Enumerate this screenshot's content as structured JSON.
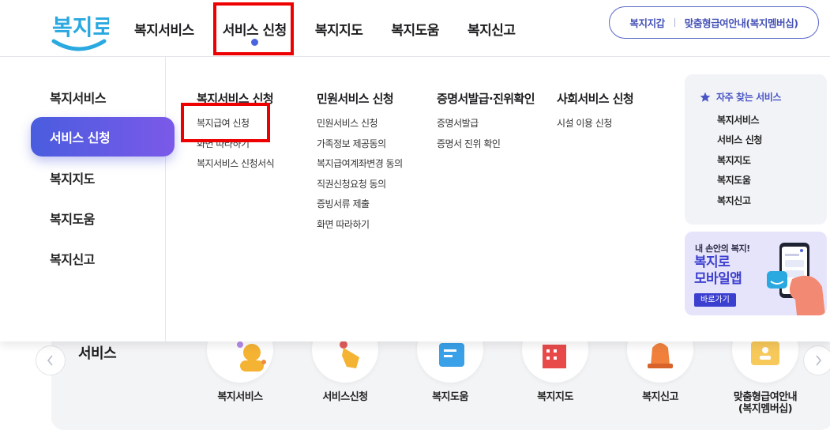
{
  "header": {
    "logo_text": "복지로",
    "nav": [
      "복지서비스",
      "서비스 신청",
      "복지지도",
      "복지도움",
      "복지신고"
    ],
    "util_links": [
      "복지지갑",
      "맞춤형급여안내(복지멤버십)"
    ]
  },
  "mega_menu": {
    "side_nav": [
      "복지서비스",
      "서비스 신청",
      "복지지도",
      "복지도움",
      "복지신고"
    ],
    "columns": [
      {
        "title": "복지서비스 신청",
        "items": [
          "복지급여 신청",
          "화면 따라하기",
          "복지서비스 신청서식"
        ]
      },
      {
        "title": "민원서비스 신청",
        "items": [
          "민원서비스 신청",
          "가족정보 제공동의",
          "복지급여계좌변경 동의",
          "직권신청요청 동의",
          "증빙서류 제출",
          "화면 따라하기"
        ]
      },
      {
        "title": "증명서발급·진위확인",
        "items": [
          "증명서발급",
          "증명서 진위 확인"
        ]
      },
      {
        "title": "사회서비스 신청",
        "items": [
          "시설 이용 신청"
        ]
      }
    ],
    "favorites": {
      "title": "자주 찾는 서비스",
      "items": [
        "복지서비스",
        "서비스 신청",
        "복지지도",
        "복지도움",
        "복지신고"
      ]
    },
    "banner": {
      "subtitle": "내 손안의 복지!",
      "title_line1": "복지로",
      "title_line2": "모바일앱",
      "button": "바로가기"
    }
  },
  "service_section": {
    "heading": "서비스",
    "items": [
      "복지서비스",
      "서비스신청",
      "복지도움",
      "복지지도",
      "복지신고",
      "맞춤형급여안내\n(복지멤버십)"
    ]
  },
  "colors": {
    "accent": "#4a5ddf",
    "accent_end": "#7b59e8",
    "highlight": "#ef0000"
  }
}
